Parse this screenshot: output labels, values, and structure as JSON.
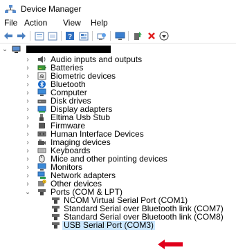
{
  "window": {
    "title": "Device Manager"
  },
  "menu": [
    "File",
    "Action",
    "View",
    "Help"
  ],
  "toolbar_icons": [
    "back-icon",
    "forward-icon",
    "properties-icon",
    "show-hidden-icon",
    "help-icon",
    "view-icon",
    "scan-hardware-icon",
    "monitor-icon",
    "add-driver-icon",
    "uninstall-icon",
    "download-icon"
  ],
  "tree": {
    "computer_name": "",
    "categories": [
      {
        "label": "Audio inputs and outputs",
        "icon": "speaker-icon"
      },
      {
        "label": "Batteries",
        "icon": "battery-icon"
      },
      {
        "label": "Biometric devices",
        "icon": "fingerprint-icon"
      },
      {
        "label": "Bluetooth",
        "icon": "bluetooth-icon"
      },
      {
        "label": "Computer",
        "icon": "computer-icon"
      },
      {
        "label": "Disk drives",
        "icon": "disk-icon"
      },
      {
        "label": "Display adapters",
        "icon": "display-adapter-icon"
      },
      {
        "label": "Eltima Usb Stub",
        "icon": "usb-icon"
      },
      {
        "label": "Firmware",
        "icon": "chip-icon"
      },
      {
        "label": "Human Interface Devices",
        "icon": "hid-icon"
      },
      {
        "label": "Imaging devices",
        "icon": "camera-icon"
      },
      {
        "label": "Keyboards",
        "icon": "keyboard-icon"
      },
      {
        "label": "Mice and other pointing devices",
        "icon": "mouse-icon"
      },
      {
        "label": "Monitors",
        "icon": "monitor-icon"
      },
      {
        "label": "Network adapters",
        "icon": "network-icon"
      },
      {
        "label": "Other devices",
        "icon": "unknown-device-icon"
      },
      {
        "label": "Ports (COM & LPT)",
        "icon": "port-icon",
        "expanded": true
      }
    ],
    "ports": [
      {
        "label": "NCOM Virtual Serial Port (COM1)"
      },
      {
        "label": "Standard Serial over Bluetooth link (COM7)"
      },
      {
        "label": "Standard Serial over Bluetooth link (COM8)"
      },
      {
        "label": "USB Serial Port (COM3)",
        "selected": true
      }
    ]
  },
  "colors": {
    "accent": "#0078d7",
    "arrow": "#e0001b",
    "folder": "#d8a838"
  }
}
